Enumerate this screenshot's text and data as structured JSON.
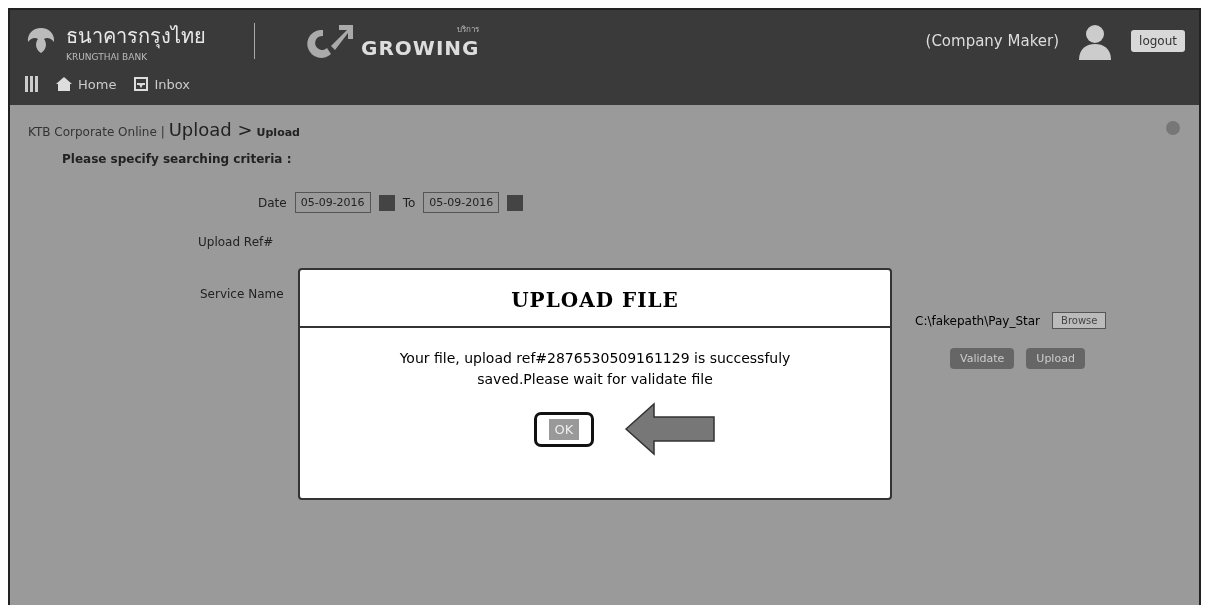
{
  "header": {
    "bank_name": "ธนาคารกรุงไทย",
    "bank_subtitle": "KRUNGTHAI BANK",
    "product_tag": "บริการ",
    "product_name": "GROWING",
    "user_name": "(Company Maker)",
    "logout": "logout"
  },
  "nav": [
    {
      "label": "Home",
      "kind": "home"
    },
    {
      "label": "Inbox",
      "kind": "inbox"
    }
  ],
  "breadcrumb": {
    "root": "KTB Corporate Online |",
    "section": "Upload >",
    "page": "Upload"
  },
  "form": {
    "heading": "Please specify searching criteria :",
    "date_label": "Date",
    "date_from": "05-09-2016",
    "to_label": "To",
    "date_to": "05-09-2016",
    "upload_ref_label": "Upload Ref#",
    "service_label": "Service Name",
    "file_path": "C:\\fakepath\\Pay_Star",
    "browse": "Browse",
    "buttons": [
      "Validate",
      "Upload"
    ]
  },
  "dialog": {
    "title": "UPLOAD FILE",
    "message": "Your file, upload ref#2876530509161129 is successfuly saved.Please wait for validate file",
    "ok": "OK"
  }
}
